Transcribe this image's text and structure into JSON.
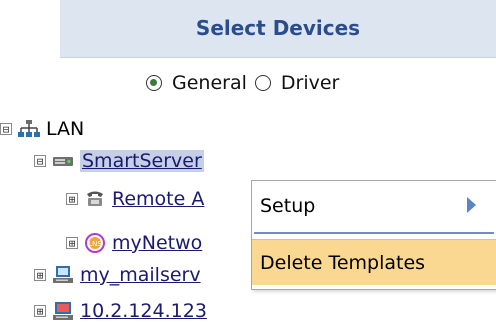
{
  "panel": {
    "title": "Select Devices"
  },
  "mode": {
    "options": [
      {
        "label": "General",
        "checked": true
      },
      {
        "label": "Driver",
        "checked": false
      }
    ]
  },
  "tree": {
    "root": {
      "label": "LAN",
      "expander": "⊟",
      "icon": "network-icon"
    },
    "nodes": [
      {
        "label": "SmartServer",
        "expander": "⊟",
        "icon": "server-icon",
        "selected": true
      },
      {
        "label": "Remote A",
        "expander": "⊞",
        "icon": "phone-icon"
      },
      {
        "label": "myNetwo",
        "expander": "⊞",
        "icon": "lns-network-icon"
      },
      {
        "label": "my_mailserv",
        "expander": "⊞",
        "icon": "mailserver-icon"
      },
      {
        "label": "10.2.124.123",
        "expander": "⊞",
        "icon": "computer-icon"
      }
    ]
  },
  "context_menu": {
    "items": [
      {
        "label": "Setup",
        "has_submenu": true
      },
      {
        "label": "Delete Templates",
        "highlighted": true
      }
    ]
  },
  "colors": {
    "header_bg": "#dde5f1",
    "title": "#2c4c8c",
    "link": "#1a1a6e",
    "menu_highlight": "#fbd892",
    "separator": "#6c8fc7"
  }
}
